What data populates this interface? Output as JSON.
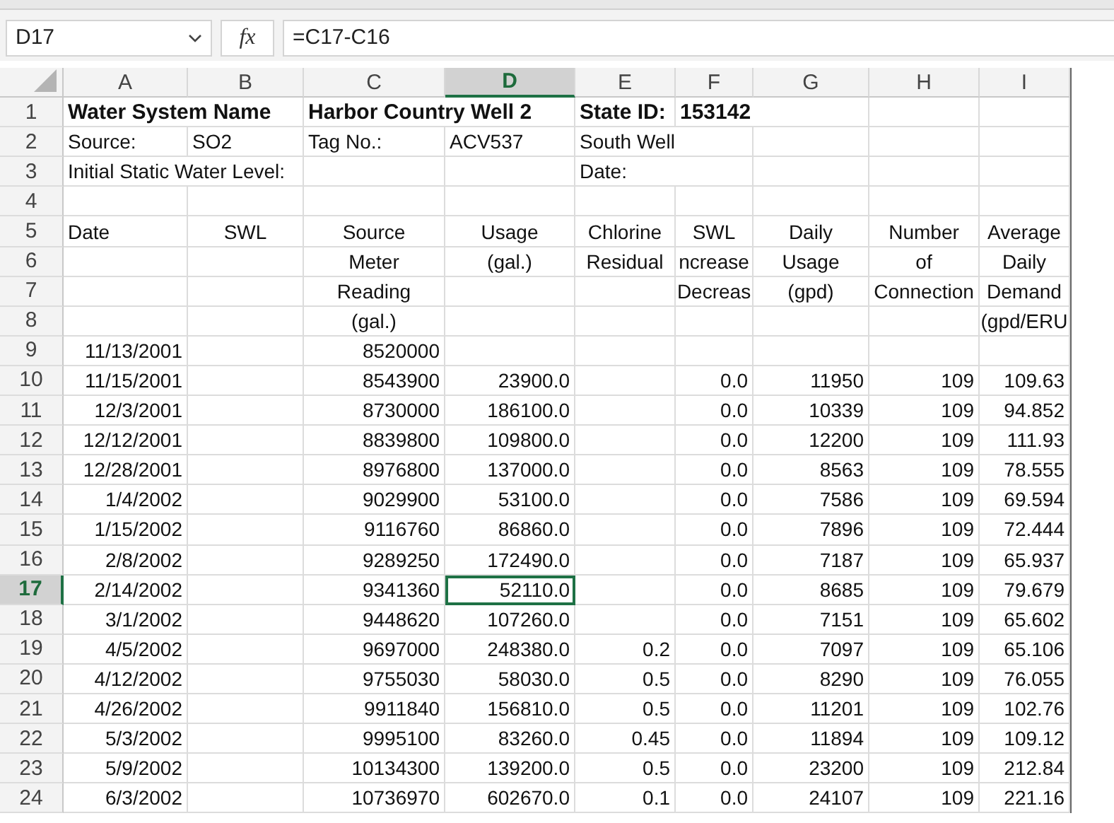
{
  "name_box": {
    "value": "D17"
  },
  "formula_bar": {
    "fx": "fx",
    "value": "=C17-C16"
  },
  "columns": [
    {
      "label": "A",
      "selected": false
    },
    {
      "label": "B",
      "selected": false
    },
    {
      "label": "C",
      "selected": false
    },
    {
      "label": "D",
      "selected": true
    },
    {
      "label": "E",
      "selected": false
    },
    {
      "label": "F",
      "selected": false
    },
    {
      "label": "G",
      "selected": false
    },
    {
      "label": "H",
      "selected": false
    },
    {
      "label": "I",
      "selected": false
    }
  ],
  "rows": [
    {
      "number": "1",
      "selected": false,
      "kind": "title",
      "cells": [
        "Water System Name",
        "",
        "Harbor Country Well 2",
        "",
        "State ID:",
        "153142",
        "",
        "",
        ""
      ]
    },
    {
      "number": "2",
      "selected": false,
      "kind": "info",
      "cells": [
        "Source:",
        "SO2",
        "Tag No.:",
        "ACV537",
        "South Well",
        "",
        "",
        "",
        ""
      ]
    },
    {
      "number": "3",
      "selected": false,
      "kind": "info",
      "cells": [
        "Initial Static Water Level:",
        "",
        "",
        "",
        "Date:",
        "",
        "",
        "",
        ""
      ]
    },
    {
      "number": "4",
      "selected": false,
      "kind": "info",
      "cells": [
        "",
        "",
        "",
        "",
        "",
        "",
        "",
        "",
        ""
      ]
    },
    {
      "number": "5",
      "selected": false,
      "kind": "header",
      "cells": [
        "Date",
        "SWL",
        "Source",
        "Usage",
        "Chlorine",
        "SWL",
        "Daily",
        "Number",
        "Average"
      ]
    },
    {
      "number": "6",
      "selected": false,
      "kind": "header",
      "cells": [
        "",
        "",
        "Meter",
        "(gal.)",
        "Residual",
        "ncrease",
        "Usage",
        "of",
        "Daily"
      ]
    },
    {
      "number": "7",
      "selected": false,
      "kind": "header",
      "cells": [
        "",
        "",
        "Reading",
        "",
        "",
        "Decreas",
        "(gpd)",
        "Connection",
        "Demand"
      ]
    },
    {
      "number": "8",
      "selected": false,
      "kind": "header",
      "cells": [
        "",
        "",
        "(gal.)",
        "",
        "",
        "",
        "",
        "",
        "(gpd/ERU"
      ]
    },
    {
      "number": "9",
      "selected": false,
      "kind": "data",
      "cells": [
        "11/13/2001",
        "",
        "8520000",
        "",
        "",
        "",
        "",
        "",
        ""
      ]
    },
    {
      "number": "10",
      "selected": false,
      "kind": "data",
      "cells": [
        "11/15/2001",
        "",
        "8543900",
        "23900.0",
        "",
        "0.0",
        "11950",
        "109",
        "109.63"
      ]
    },
    {
      "number": "11",
      "selected": false,
      "kind": "data",
      "cells": [
        "12/3/2001",
        "",
        "8730000",
        "186100.0",
        "",
        "0.0",
        "10339",
        "109",
        "94.852"
      ]
    },
    {
      "number": "12",
      "selected": false,
      "kind": "data",
      "cells": [
        "12/12/2001",
        "",
        "8839800",
        "109800.0",
        "",
        "0.0",
        "12200",
        "109",
        "111.93"
      ]
    },
    {
      "number": "13",
      "selected": false,
      "kind": "data",
      "cells": [
        "12/28/2001",
        "",
        "8976800",
        "137000.0",
        "",
        "0.0",
        "8563",
        "109",
        "78.555"
      ]
    },
    {
      "number": "14",
      "selected": false,
      "kind": "data",
      "cells": [
        "1/4/2002",
        "",
        "9029900",
        "53100.0",
        "",
        "0.0",
        "7586",
        "109",
        "69.594"
      ]
    },
    {
      "number": "15",
      "selected": false,
      "kind": "data",
      "cells": [
        "1/15/2002",
        "",
        "9116760",
        "86860.0",
        "",
        "0.0",
        "7896",
        "109",
        "72.444"
      ]
    },
    {
      "number": "16",
      "selected": false,
      "kind": "data",
      "cells": [
        "2/8/2002",
        "",
        "9289250",
        "172490.0",
        "",
        "0.0",
        "7187",
        "109",
        "65.937"
      ]
    },
    {
      "number": "17",
      "selected": true,
      "kind": "data",
      "cells": [
        "2/14/2002",
        "",
        "9341360",
        "52110.0",
        "",
        "0.0",
        "8685",
        "109",
        "79.679"
      ]
    },
    {
      "number": "18",
      "selected": false,
      "kind": "data",
      "cells": [
        "3/1/2002",
        "",
        "9448620",
        "107260.0",
        "",
        "0.0",
        "7151",
        "109",
        "65.602"
      ]
    },
    {
      "number": "19",
      "selected": false,
      "kind": "data",
      "cells": [
        "4/5/2002",
        "",
        "9697000",
        "248380.0",
        "0.2",
        "0.0",
        "7097",
        "109",
        "65.106"
      ]
    },
    {
      "number": "20",
      "selected": false,
      "kind": "data",
      "cells": [
        "4/12/2002",
        "",
        "9755030",
        "58030.0",
        "0.5",
        "0.0",
        "8290",
        "109",
        "76.055"
      ]
    },
    {
      "number": "21",
      "selected": false,
      "kind": "data",
      "cells": [
        "4/26/2002",
        "",
        "9911840",
        "156810.0",
        "0.5",
        "0.0",
        "11201",
        "109",
        "102.76"
      ]
    },
    {
      "number": "22",
      "selected": false,
      "kind": "data",
      "cells": [
        "5/3/2002",
        "",
        "9995100",
        "83260.0",
        "0.45",
        "0.0",
        "11894",
        "109",
        "109.12"
      ]
    },
    {
      "number": "23",
      "selected": false,
      "kind": "data",
      "cells": [
        "5/9/2002",
        "",
        "10134300",
        "139200.0",
        "0.5",
        "0.0",
        "23200",
        "109",
        "212.84"
      ]
    },
    {
      "number": "24",
      "selected": false,
      "kind": "data",
      "cells": [
        "6/3/2002",
        "",
        "10736970",
        "602670.0",
        "0.1",
        "0.0",
        "24107",
        "109",
        "221.16"
      ]
    }
  ]
}
